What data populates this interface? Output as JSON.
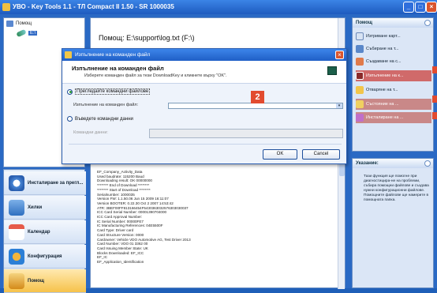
{
  "window": {
    "title": "УВО - Key Tools 1.1 - ТЛ Compact II 1.50 - SR 1000035"
  },
  "tree": {
    "root_label": "Помощ",
    "child_label": "E:\\"
  },
  "nav": [
    {
      "label": "Инсталиране за прегл...",
      "icon": "clock-icon"
    },
    {
      "label": "Хилки",
      "icon": "user-icon"
    },
    {
      "label": "Календар",
      "icon": "calendar-icon"
    },
    {
      "label": "Конфигурация",
      "icon": "gear-icon"
    },
    {
      "label": "Помощ",
      "icon": "help-user-icon"
    }
  ],
  "center": {
    "header": "Помощ: E:\\support\\log.txt   (F:\\)",
    "log_lines": [
      "EF_Company_Activity_Data",
      "Used baudrate: 115200 Baud",
      "Downloading result: OK 00000000",
      "******** End of Download ********",
      "******** Start of Download ********",
      "Serialnumber: 1000035",
      "Version FW: 1.1.50.06 Jun 15 2009 16:11:07",
      "Version BOOTER: 0.22.30 Oct  2 2007 14:53:42",
      "ATR: 3BEF00FF813166454F5430363032576303030037",
      "ICC Card Serial Number: 00001390704000",
      "ICC Card Approval Number:",
      "IC Serial Number: 00000FE7",
      "IC Manufacturing References: 04E5500F",
      "Card Type: Driver card",
      "Card Structure Version: 0000",
      "Cardowner: Vehicle VDO Automotive AG, Test Driver 2013",
      "Card Number: VDO 01   3362  00",
      "Card Issuing Member State: UK",
      "Blocks Downloaded: EF_ICC",
      "          EF_IC",
      "          EF_Application_Identification"
    ]
  },
  "tasks": {
    "header": "Помощ",
    "items": [
      {
        "label": "Изтриване карт...",
        "icon": "delete-card-icon"
      },
      {
        "label": "Събиране на т...",
        "icon": "collect-icon"
      },
      {
        "label": "Създаване на с...",
        "icon": "create-icon"
      },
      {
        "label": "Изпълнение на к...",
        "icon": "run-command-icon"
      },
      {
        "label": "Отваряне на т...",
        "icon": "folder-icon"
      },
      {
        "label": "Състояние на ...",
        "icon": "state-icon"
      },
      {
        "label": "Инсталиране на ...",
        "icon": "install-icon"
      }
    ]
  },
  "hint": {
    "header": "Указание:",
    "text": "Тази функция ще помогне при диагностицира-не на проблеми, събира помощни файлове и създава нужни конфигурационни файлове. Помощните файлове ще намерите в помощната папка."
  },
  "dialog": {
    "title": "Изпълнение на команден файл",
    "heading": "Изпълнение на команден файл",
    "subheading": "Изберете команден файл за тези DownloadKey и кликнете върху \"OK\".",
    "opt_browse": "Прегледайте командни файлове",
    "file_label": "Изпълнение на команден файл:",
    "opt_enter": "Въведете командни данни",
    "data_label": "Командни данни:",
    "ok": "OK",
    "cancel": "Cancel",
    "badge": "2"
  },
  "colors": {
    "accent": "#2a69c4",
    "highlight": "#d06a6a",
    "marker": "#e24b2f"
  }
}
